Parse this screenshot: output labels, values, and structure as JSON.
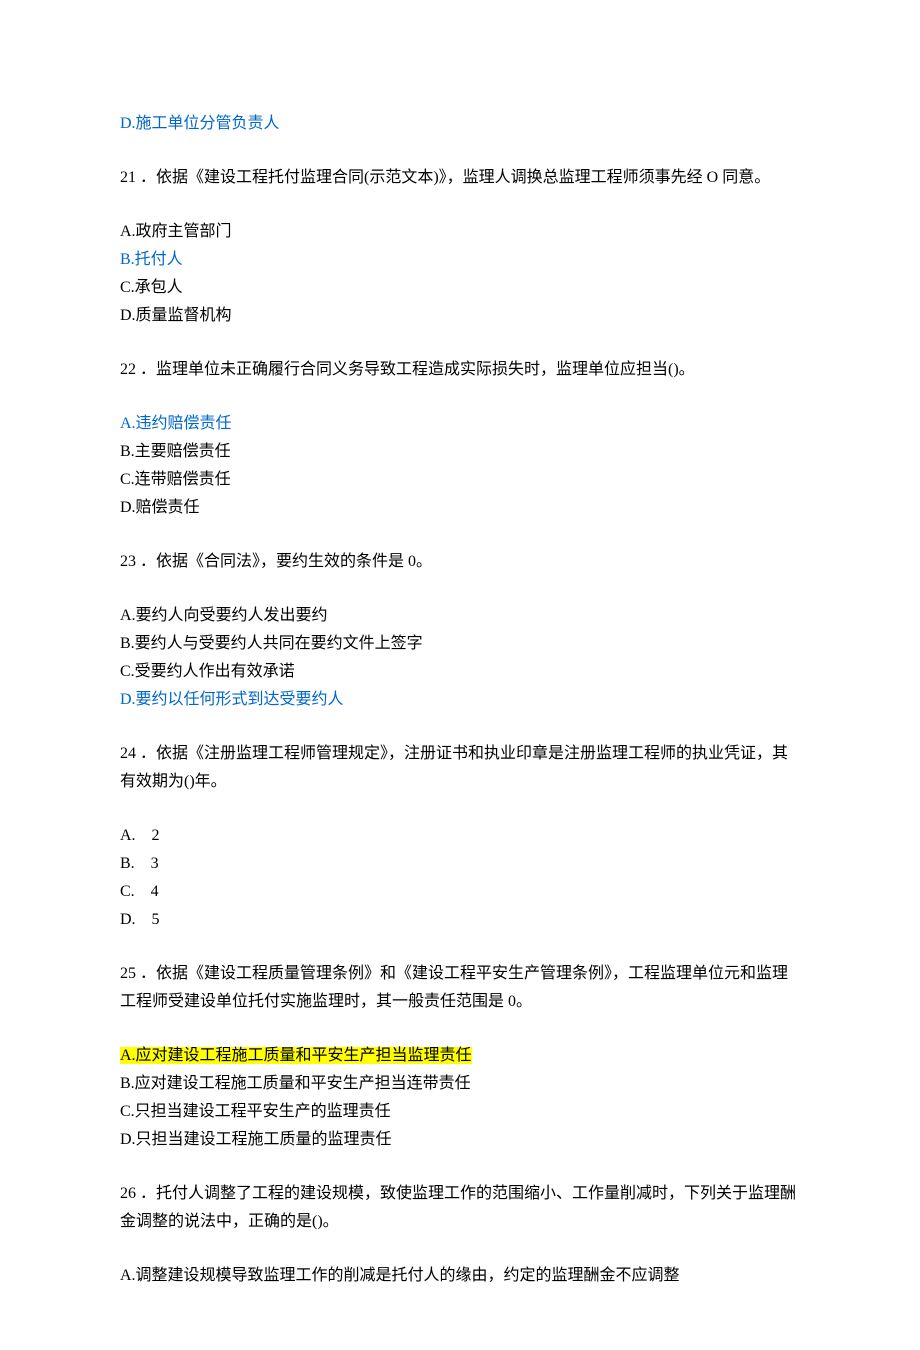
{
  "q20": {
    "d": "D.施工单位分管负责人"
  },
  "q21": {
    "stem": "21 ．依据《建设工程托付监理合同(示范文本)》，监理人调换总监理工程师须事先经 O 同意。",
    "a": "A.政府主管部门",
    "b": "B.托付人",
    "c": "C.承包人",
    "d": "D.质量监督机构"
  },
  "q22": {
    "stem": "22 ．监理单位未正确履行合同义务导致工程造成实际损失时，监理单位应担当()。",
    "a": "A.违约赔偿责任",
    "b": "B.主要赔偿责任",
    "c": "C.连带赔偿责任",
    "d": "D.赔偿责任"
  },
  "q23": {
    "stem": "23 ．依据《合同法》，要约生效的条件是 0。",
    "a": "A.要约人向受要约人发出要约",
    "b": "B.要约人与受要约人共同在要约文件上签字",
    "c": "C.受要约人作出有效承诺",
    "d": "D.要约以任何形式到达受要约人"
  },
  "q24": {
    "stem": "24 ．依据《注册监理工程师管理规定》，注册证书和执业印章是注册监理工程师的执业凭证，其有效期为()年。",
    "a": "A.　2",
    "b": "B.　3",
    "c": "C.　4",
    "d": "D.　5"
  },
  "q25": {
    "stem": "25 ．依据《建设工程质量管理条例》和《建设工程平安生产管理条例》，工程监理单位元和监理工程师受建设单位托付实施监理时，其一般责任范围是 0。",
    "a": "A.应对建设工程施工质量和平安生产担当监理责任",
    "b": "B.应对建设工程施工质量和平安生产担当连带责任",
    "c": "C.只担当建设工程平安生产的监理责任",
    "d": "D.只担当建设工程施工质量的监理责任"
  },
  "q26": {
    "stem": "26 ．托付人调整了工程的建设规模，致使监理工作的范围缩小、工作量削减时，下列关于监理酬金调整的说法中，正确的是()。",
    "a": "A.调整建设规模导致监理工作的削减是托付人的缘由，约定的监理酬金不应调整"
  }
}
